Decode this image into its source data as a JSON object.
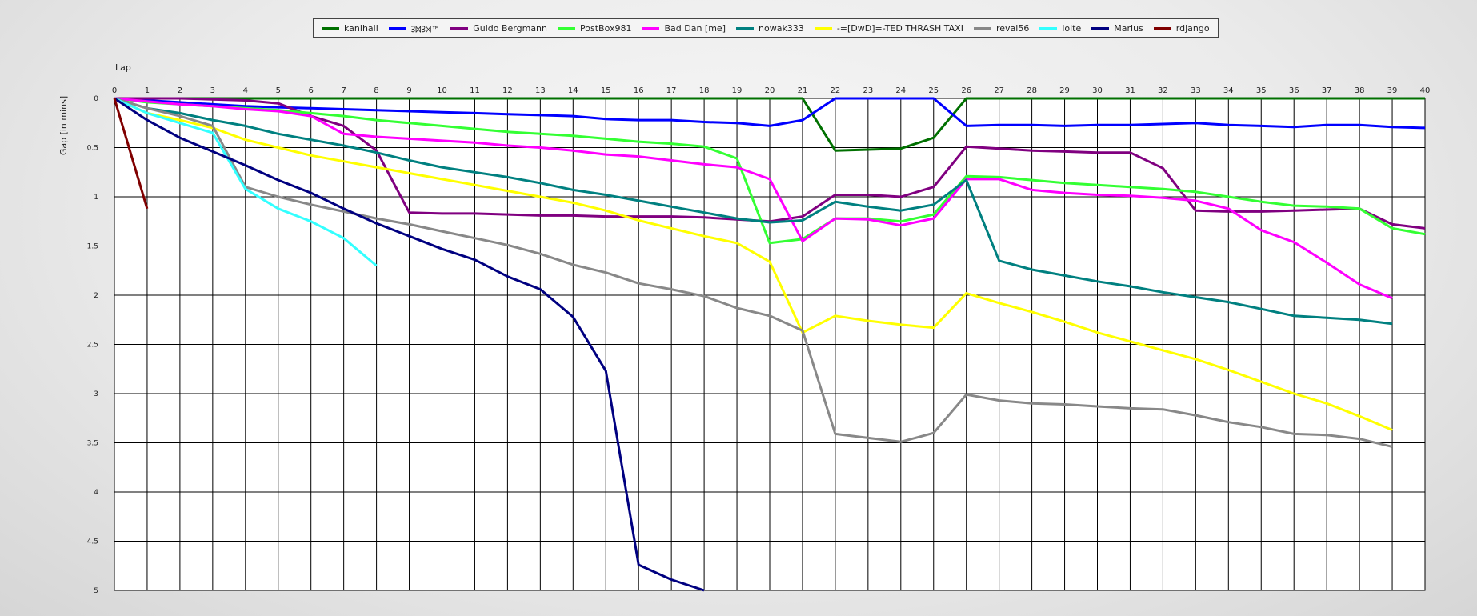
{
  "chart_data": {
    "type": "line",
    "title": "",
    "xlabel": "Lap",
    "ylabel": "Gap [in mins]",
    "xlim": [
      0,
      40
    ],
    "ylim": [
      0,
      5
    ],
    "y_inverted": true,
    "grid": true,
    "legend_position": "top-center",
    "x_ticks": [
      0,
      1,
      2,
      3,
      4,
      5,
      6,
      7,
      8,
      9,
      10,
      11,
      12,
      13,
      14,
      15,
      16,
      17,
      18,
      19,
      20,
      21,
      22,
      23,
      24,
      25,
      26,
      27,
      28,
      29,
      30,
      31,
      32,
      33,
      34,
      35,
      36,
      37,
      38,
      39,
      40
    ],
    "y_ticks": [
      "0",
      "0.5",
      "1",
      "1.5",
      "2",
      "2.5",
      "3",
      "3.5",
      "4",
      "4.5",
      "5"
    ],
    "series": [
      {
        "name": "kanihali",
        "color": "#007000",
        "values": [
          0,
          0,
          0,
          0,
          0,
          0,
          0,
          0,
          0,
          0,
          0,
          0,
          0,
          0,
          0,
          0,
          0,
          0,
          0,
          0,
          0,
          0,
          0.53,
          0.52,
          0.51,
          0.4,
          0,
          0,
          0,
          0,
          0,
          0,
          0,
          0,
          0,
          0,
          0,
          0,
          0,
          0,
          0
        ]
      },
      {
        "name": "ᢃᢂᢃᢂ™",
        "color": "#0000ff",
        "values": [
          0,
          0.02,
          0.04,
          0.06,
          0.08,
          0.09,
          0.1,
          0.11,
          0.12,
          0.13,
          0.14,
          0.15,
          0.16,
          0.17,
          0.18,
          0.21,
          0.22,
          0.22,
          0.24,
          0.25,
          0.28,
          0.22,
          0,
          0,
          0,
          0,
          0.28,
          0.27,
          0.27,
          0.28,
          0.27,
          0.27,
          0.26,
          0.25,
          0.27,
          0.28,
          0.29,
          0.27,
          0.27,
          0.29,
          0.3
        ]
      },
      {
        "name": "Guido Bergmann",
        "color": "#800080",
        "values": [
          0,
          0,
          0,
          0.01,
          0.02,
          0.05,
          0.18,
          0.28,
          0.53,
          1.16,
          1.17,
          1.17,
          1.18,
          1.19,
          1.19,
          1.2,
          1.2,
          1.2,
          1.21,
          1.23,
          1.25,
          1.2,
          0.98,
          0.98,
          1.0,
          0.9,
          0.49,
          0.51,
          0.53,
          0.54,
          0.55,
          0.55,
          0.71,
          1.14,
          1.15,
          1.15,
          1.14,
          1.13,
          1.12,
          1.28,
          1.32
        ]
      },
      {
        "name": "PostBox981",
        "color": "#33ff33",
        "values": [
          0,
          0.04,
          0.06,
          0.08,
          0.1,
          0.12,
          0.15,
          0.18,
          0.22,
          0.25,
          0.28,
          0.31,
          0.34,
          0.36,
          0.38,
          0.41,
          0.44,
          0.46,
          0.49,
          0.61,
          1.47,
          1.43,
          1.22,
          1.22,
          1.25,
          1.18,
          0.79,
          0.8,
          0.83,
          0.86,
          0.88,
          0.9,
          0.92,
          0.95,
          1.0,
          1.05,
          1.09,
          1.1,
          1.12,
          1.32,
          1.38
        ]
      },
      {
        "name": "Bad Dan [me]",
        "color": "#ff00ff",
        "values": [
          0,
          0.03,
          0.06,
          0.08,
          0.11,
          0.13,
          0.18,
          0.36,
          0.39,
          0.41,
          0.43,
          0.45,
          0.48,
          0.5,
          0.53,
          0.57,
          0.59,
          0.63,
          0.67,
          0.7,
          0.82,
          1.45,
          1.22,
          1.23,
          1.29,
          1.22,
          0.82,
          0.82,
          0.93,
          0.96,
          0.98,
          0.99,
          1.01,
          1.04,
          1.12,
          1.34,
          1.46,
          1.67,
          1.89,
          2.03,
          null
        ]
      },
      {
        "name": "nowak333",
        "color": "#008080",
        "values": [
          0,
          0.1,
          0.15,
          0.22,
          0.28,
          0.36,
          0.42,
          0.48,
          0.55,
          0.63,
          0.7,
          0.75,
          0.8,
          0.86,
          0.93,
          0.98,
          1.04,
          1.1,
          1.16,
          1.22,
          1.26,
          1.24,
          1.05,
          1.1,
          1.14,
          1.08,
          0.83,
          1.65,
          1.74,
          1.8,
          1.86,
          1.91,
          1.97,
          2.02,
          2.07,
          2.14,
          2.21,
          2.23,
          2.25,
          2.29,
          null
        ]
      },
      {
        "name": "-=[DwD]=-TED THRASH TAXI",
        "color": "#ffff00",
        "values": [
          0,
          0.15,
          0.22,
          0.3,
          0.42,
          0.5,
          0.58,
          0.64,
          0.7,
          0.76,
          0.82,
          0.88,
          0.94,
          1.0,
          1.06,
          1.14,
          1.24,
          1.32,
          1.4,
          1.47,
          1.66,
          2.38,
          2.21,
          2.26,
          2.3,
          2.33,
          1.98,
          2.08,
          2.17,
          2.27,
          2.38,
          2.47,
          2.56,
          2.65,
          2.76,
          2.88,
          3.0,
          3.1,
          3.23,
          3.37,
          null
        ]
      },
      {
        "name": "reval56",
        "color": "#888888",
        "values": [
          0,
          0.1,
          0.18,
          0.28,
          0.9,
          1.0,
          1.08,
          1.15,
          1.22,
          1.28,
          1.35,
          1.42,
          1.49,
          1.58,
          1.69,
          1.77,
          1.88,
          1.94,
          2.01,
          2.13,
          2.21,
          2.36,
          3.41,
          3.45,
          3.49,
          3.4,
          3.01,
          3.07,
          3.1,
          3.11,
          3.13,
          3.15,
          3.16,
          3.22,
          3.29,
          3.34,
          3.41,
          3.42,
          3.46,
          3.54,
          null
        ]
      },
      {
        "name": "loite",
        "color": "#33ffff",
        "values": [
          0,
          0.15,
          0.25,
          0.35,
          0.92,
          1.12,
          1.25,
          1.42,
          1.7,
          null,
          null,
          null,
          null,
          null,
          null,
          null,
          null,
          null,
          null,
          null,
          null,
          null,
          null,
          null,
          null,
          null,
          null,
          null,
          null,
          null,
          null,
          null,
          null,
          null,
          null,
          null,
          null,
          null,
          null,
          null,
          null
        ]
      },
      {
        "name": "Marius",
        "color": "#000080",
        "values": [
          0,
          0.22,
          0.4,
          0.54,
          0.68,
          0.83,
          0.96,
          1.12,
          1.27,
          1.4,
          1.53,
          1.64,
          1.81,
          1.94,
          2.22,
          2.77,
          4.74,
          4.89,
          5.0,
          null,
          null,
          null,
          null,
          null,
          null,
          null,
          null,
          null,
          null,
          null,
          null,
          null,
          null,
          null,
          null,
          null,
          null,
          null,
          null,
          null,
          null
        ]
      },
      {
        "name": "rdjango",
        "color": "#800000",
        "values": [
          0,
          1.12,
          null,
          null,
          null,
          null,
          null,
          null,
          null,
          null,
          null,
          null,
          null,
          null,
          null,
          null,
          null,
          null,
          null,
          null,
          null,
          null,
          null,
          null,
          null,
          null,
          null,
          null,
          null,
          null,
          null,
          null,
          null,
          null,
          null,
          null,
          null,
          null,
          null,
          null,
          null
        ]
      }
    ]
  }
}
